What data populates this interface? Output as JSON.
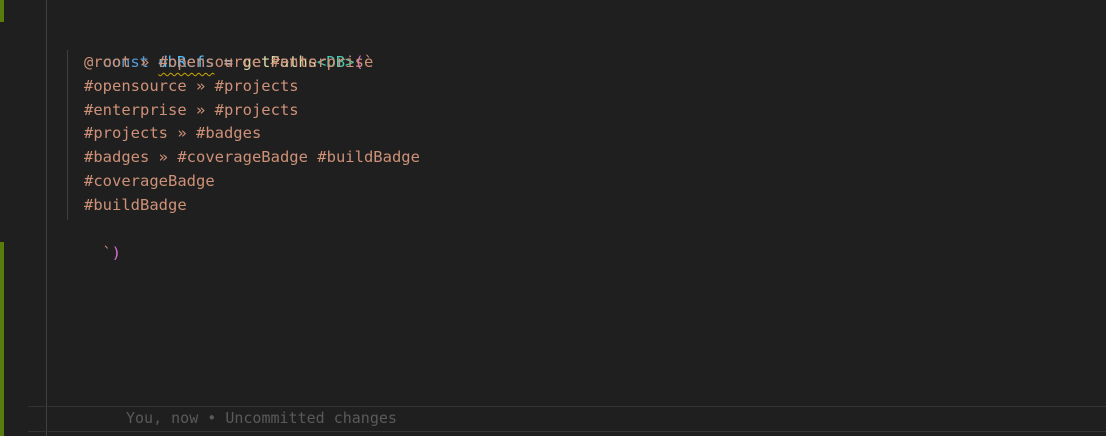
{
  "code": {
    "line1": {
      "keyword": "const",
      "variable": "dbRefs",
      "operator": "=",
      "function": "getPaths",
      "generic_open": "<",
      "type": "DB",
      "generic_close": ">",
      "paren_open": "(",
      "backtick": "`"
    },
    "template_lines": [
      "@root » #opensource #enterprise",
      "#opensource » #projects",
      "#enterprise » #projects",
      "#projects » #badges",
      "#badges » #coverageBadge #buildBadge",
      "#coverageBadge",
      "#buildBadge"
    ],
    "closing": {
      "backtick": "`",
      "paren_close": ")"
    }
  },
  "blame": {
    "text": "You, now • Uncommitted changes"
  },
  "colors": {
    "background": "#1f1f1f",
    "keyword": "#569cd6",
    "variable": "#4fc1ff",
    "function": "#dcdcaa",
    "type": "#4ec9b0",
    "string": "#ce9178",
    "paren": "#da70d6",
    "gutter_modified": "#587c0c",
    "warning_squiggle": "#cca700"
  }
}
